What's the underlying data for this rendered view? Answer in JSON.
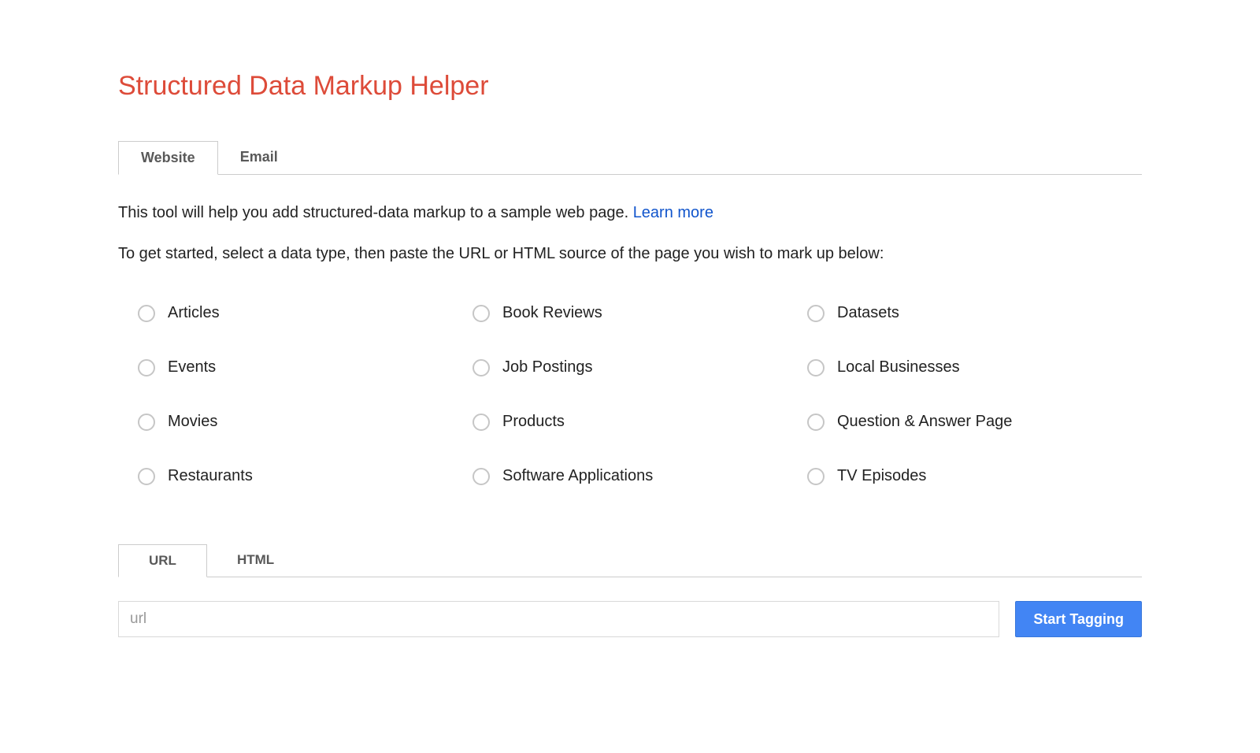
{
  "title": "Structured Data Markup Helper",
  "tabs": {
    "website": "Website",
    "email": "Email"
  },
  "intro_text": "This tool will help you add structured-data markup to a sample web page. ",
  "learn_more": "Learn more",
  "instruction": "To get started, select a data type, then paste the URL or HTML source of the page you wish to mark up below:",
  "options": {
    "articles": "Articles",
    "book_reviews": "Book Reviews",
    "datasets": "Datasets",
    "events": "Events",
    "job_postings": "Job Postings",
    "local_businesses": "Local Businesses",
    "movies": "Movies",
    "products": "Products",
    "qa_page": "Question & Answer Page",
    "restaurants": "Restaurants",
    "software_apps": "Software Applications",
    "tv_episodes": "TV Episodes"
  },
  "input_tabs": {
    "url": "URL",
    "html": "HTML"
  },
  "url_placeholder": "url",
  "start_button": "Start Tagging"
}
